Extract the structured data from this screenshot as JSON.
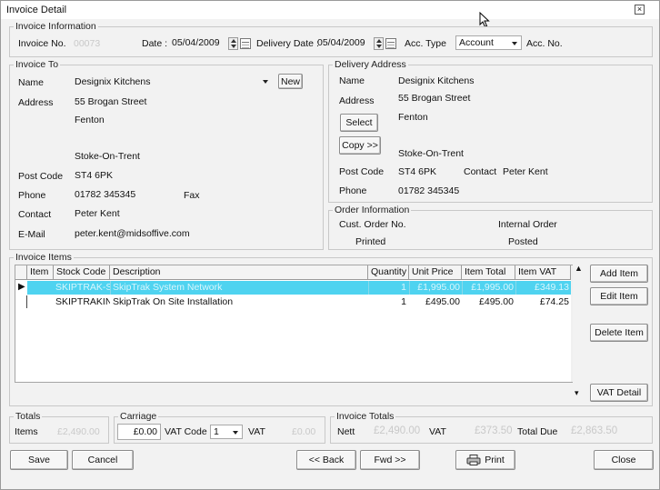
{
  "window": {
    "title": "Invoice Detail"
  },
  "invoice_information": {
    "legend": "Invoice Information",
    "invoice_no_label": "Invoice No.",
    "invoice_no_value": "00073",
    "date_label": "Date :",
    "date_value": "05/04/2009",
    "delivery_date_label": "Delivery Date :",
    "delivery_date_value": "05/04/2009",
    "acc_type_label": "Acc. Type",
    "acc_type_value": "Account",
    "acc_no_label": "Acc. No."
  },
  "invoice_to": {
    "legend": "Invoice To",
    "name_label": "Name",
    "name_value": "Designix Kitchens",
    "new_button": "New",
    "address_label": "Address",
    "address_lines": [
      "55 Brogan Street",
      "Fenton",
      "",
      "Stoke-On-Trent"
    ],
    "post_code_label": "Post Code",
    "post_code_value": "ST4 6PK",
    "phone_label": "Phone",
    "phone_value": "01782 345345",
    "fax_label": "Fax",
    "contact_label": "Contact",
    "contact_value": "Peter Kent",
    "email_label": "E-Mail",
    "email_value": "peter.kent@midsoffive.com"
  },
  "delivery_address": {
    "legend": "Delivery Address",
    "name_label": "Name",
    "name_value": "Designix Kitchens",
    "address_label": "Address",
    "address_lines": [
      "55 Brogan Street",
      "Fenton",
      "",
      "Stoke-On-Trent"
    ],
    "select_button": "Select",
    "copy_button": "Copy >>",
    "post_code_label": "Post Code",
    "post_code_value": "ST4 6PK",
    "contact_label": "Contact",
    "contact_value": "Peter Kent",
    "phone_label": "Phone",
    "phone_value": "01782 345345"
  },
  "order_information": {
    "legend": "Order Information",
    "cust_order_label": "Cust. Order No.",
    "internal_order_label": "Internal Order",
    "printed_label": "Printed",
    "posted_label": "Posted"
  },
  "invoice_items": {
    "legend": "Invoice Items",
    "columns": [
      "Item",
      "Stock Code",
      "Description",
      "Quantity",
      "Unit Price",
      "Item Total",
      "Item VAT"
    ],
    "rows": [
      {
        "item": "",
        "stock_code": "SKIPTRAK-SYS",
        "description": "SkipTrak System Network",
        "quantity": "1",
        "unit_price": "£1,995.00",
        "item_total": "£1,995.00",
        "item_vat": "£349.13"
      },
      {
        "item": "",
        "stock_code": "SKIPTRAKINS",
        "description": "SkipTrak On Site Installation",
        "quantity": "1",
        "unit_price": "£495.00",
        "item_total": "£495.00",
        "item_vat": "£74.25"
      }
    ],
    "add_item_button": "Add Item",
    "edit_item_button": "Edit Item",
    "delete_item_button": "Delete Item",
    "vat_detail_button": "VAT Detail"
  },
  "totals": {
    "legend": "Totals",
    "items_label": "Items",
    "items_value": "£2,490.00"
  },
  "carriage": {
    "legend": "Carriage",
    "carriage_value": "£0.00",
    "vat_code_label": "VAT Code",
    "vat_code_value": "1",
    "vat_label": "VAT",
    "vat_value": "£0.00"
  },
  "invoice_totals": {
    "legend": "Invoice Totals",
    "nett_label": "Nett",
    "nett_value": "£2,490.00",
    "vat_label": "VAT",
    "vat_value": "£373.50",
    "total_due_label": "Total Due",
    "total_due_value": "£2,863.50"
  },
  "footer": {
    "save_button": "Save",
    "cancel_button": "Cancel",
    "back_button": "<< Back",
    "fwd_button": "Fwd >>",
    "print_button": "Print",
    "close_button": "Close"
  }
}
